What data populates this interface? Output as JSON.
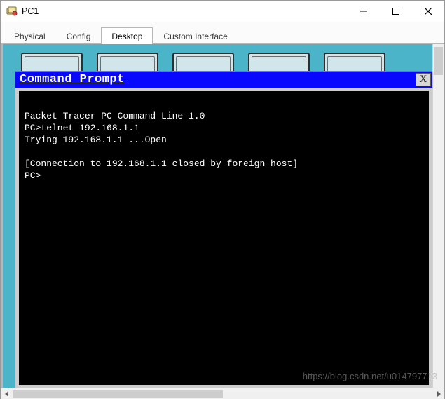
{
  "window": {
    "title": "PC1",
    "buttons": {
      "min": "minimize",
      "max": "maximize",
      "close": "close"
    }
  },
  "tabs": [
    {
      "id": "physical",
      "label": "Physical",
      "active": false
    },
    {
      "id": "config",
      "label": "Config",
      "active": false
    },
    {
      "id": "desktop",
      "label": "Desktop",
      "active": true
    },
    {
      "id": "custom",
      "label": "Custom Interface",
      "active": false
    }
  ],
  "cmd": {
    "title": "Command Prompt",
    "close_label": "X",
    "lines": [
      "",
      "Packet Tracer PC Command Line 1.0",
      "PC>telnet 192.168.1.1",
      "Trying 192.168.1.1 ...Open",
      "",
      "[Connection to 192.168.1.1 closed by foreign host]",
      "PC>"
    ]
  },
  "watermark": "https://blog.csdn.net/u014797713"
}
